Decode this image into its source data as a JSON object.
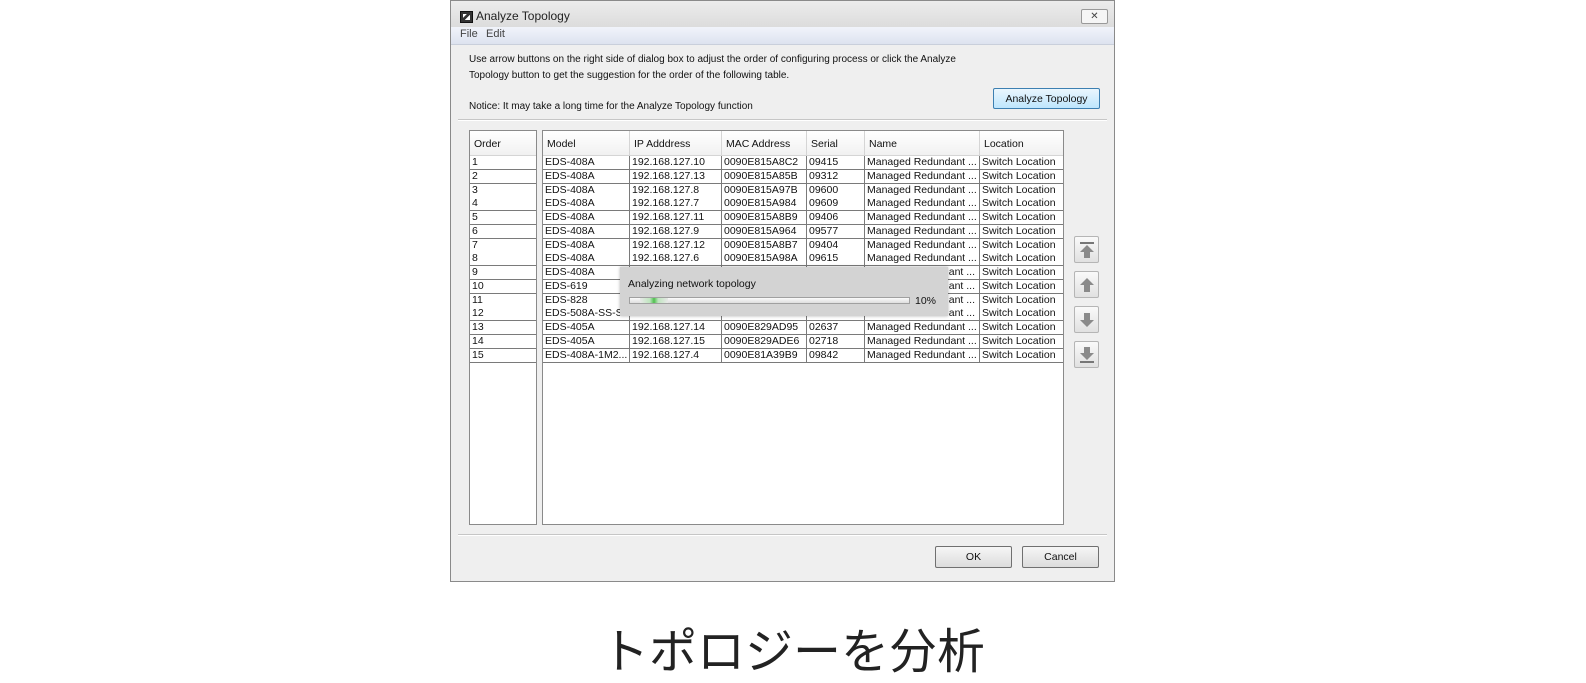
{
  "window": {
    "title": "Analyze Topology",
    "close_glyph": "✕"
  },
  "menu": [
    "File",
    "Edit"
  ],
  "instructions": {
    "line1": "Use arrow buttons on the right side of dialog box to adjust the order of configuring process or click the Analyze",
    "line2": "Topology button to get the suggestion for the order of the following table.",
    "notice": "Notice: It may take a long time for the Analyze Topology function"
  },
  "analyze_button": "Analyze Topology",
  "order_table": {
    "header": "Order"
  },
  "main_table": {
    "columns": [
      "Model",
      "IP Adddress",
      "MAC Address",
      "Serial",
      "Name",
      "Location"
    ],
    "rows": [
      {
        "order": "1",
        "model": "EDS-408A",
        "ip": "192.168.127.10",
        "mac": "0090E815A8C2",
        "serial": "09415",
        "name": "Managed Redundant ...",
        "location": "Switch Location"
      },
      {
        "order": "2",
        "model": "EDS-408A",
        "ip": "192.168.127.13",
        "mac": "0090E815A85B",
        "serial": "09312",
        "name": "Managed Redundant ...",
        "location": "Switch Location"
      },
      {
        "order": "3",
        "model": "EDS-408A",
        "ip": "192.168.127.8",
        "mac": "0090E815A97B",
        "serial": "09600",
        "name": "Managed Redundant ...",
        "location": "Switch Location"
      },
      {
        "order": "4",
        "model": "EDS-408A",
        "ip": "192.168.127.7",
        "mac": "0090E815A984",
        "serial": "09609",
        "name": "Managed Redundant ...",
        "location": "Switch Location"
      },
      {
        "order": "5",
        "model": "EDS-408A",
        "ip": "192.168.127.11",
        "mac": "0090E815A8B9",
        "serial": "09406",
        "name": "Managed Redundant ...",
        "location": "Switch Location"
      },
      {
        "order": "6",
        "model": "EDS-408A",
        "ip": "192.168.127.9",
        "mac": "0090E815A964",
        "serial": "09577",
        "name": "Managed Redundant ...",
        "location": "Switch Location"
      },
      {
        "order": "7",
        "model": "EDS-408A",
        "ip": "192.168.127.12",
        "mac": "0090E815A8B7",
        "serial": "09404",
        "name": "Managed Redundant ...",
        "location": "Switch Location"
      },
      {
        "order": "8",
        "model": "EDS-408A",
        "ip": "192.168.127.6",
        "mac": "0090E815A98A",
        "serial": "09615",
        "name": "Managed Redundant ...",
        "location": "Switch Location"
      },
      {
        "order": "9",
        "model": "EDS-408A",
        "ip": "",
        "mac": "",
        "serial": "",
        "name": "ant ...",
        "location": "Switch Location"
      },
      {
        "order": "10",
        "model": "EDS-619",
        "ip": "",
        "mac": "",
        "serial": "",
        "name": "ant ...",
        "location": "Switch Location"
      },
      {
        "order": "11",
        "model": "EDS-828",
        "ip": "",
        "mac": "",
        "serial": "",
        "name": "ant ...",
        "location": "Switch Location"
      },
      {
        "order": "12",
        "model": "EDS-508A-SS-S",
        "ip": "",
        "mac": "",
        "serial": "",
        "name": "ant ...",
        "location": "Switch Location"
      },
      {
        "order": "13",
        "model": "EDS-405A",
        "ip": "192.168.127.14",
        "mac": "0090E829AD95",
        "serial": "02637",
        "name": "Managed Redundant ...",
        "location": "Switch Location"
      },
      {
        "order": "14",
        "model": "EDS-405A",
        "ip": "192.168.127.15",
        "mac": "0090E829ADE6",
        "serial": "02718",
        "name": "Managed Redundant ...",
        "location": "Switch Location"
      },
      {
        "order": "15",
        "model": "EDS-408A-1M2...",
        "ip": "192.168.127.4",
        "mac": "0090E81A39B9",
        "serial": "09842",
        "name": "Managed Redundant ...",
        "location": "Switch Location"
      }
    ]
  },
  "order_buttons": [
    "move-top-icon",
    "move-up-icon",
    "move-down-icon",
    "move-bottom-icon"
  ],
  "progress": {
    "label": "Analyzing network topology",
    "percent_text": "10%",
    "value": 0.1
  },
  "buttons": {
    "ok": "OK",
    "cancel": "Cancel"
  },
  "caption": "トポロジーを分析",
  "colors": {
    "progress_green": "#4fbf4f",
    "button_blue_border": "#3c7fb1"
  }
}
